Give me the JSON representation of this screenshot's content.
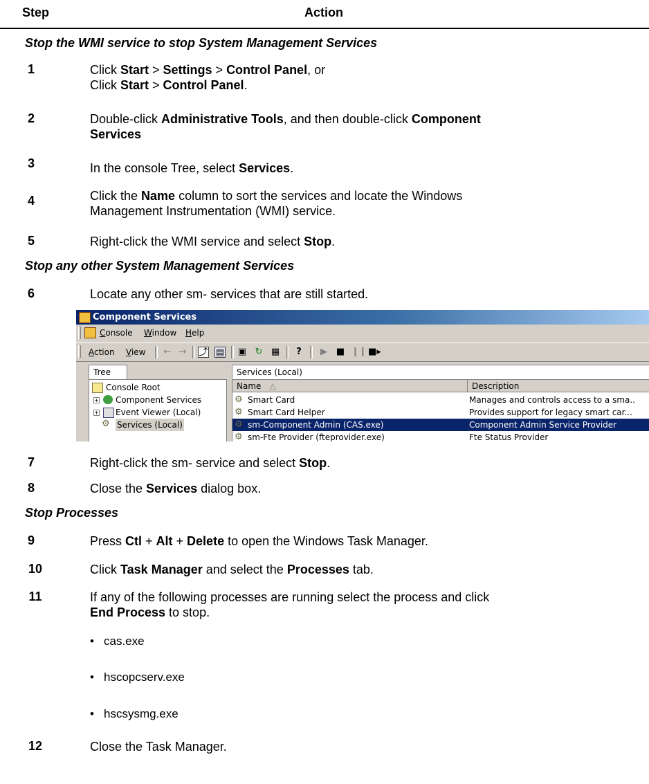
{
  "header": {
    "step_label": "Step",
    "action_label": "Action"
  },
  "sections": [
    "Stop the WMI service to stop System Management Services",
    "Stop any other System Management Services",
    "Stop Processes"
  ],
  "steps": [
    {
      "num": "1",
      "line1": [
        "Click ",
        "Start",
        " > ",
        "Settings",
        " > ",
        "Control Panel",
        ", or"
      ],
      "line2": [
        "Click ",
        "Start",
        " > ",
        "Control Panel",
        "."
      ]
    },
    {
      "num": "2",
      "line1": [
        "Double-click ",
        "Administrative Tools",
        ", and then double-click ",
        "Component"
      ],
      "line2": [
        "Services"
      ]
    },
    {
      "num": "3",
      "line1": [
        "In the console Tree, select ",
        "Services",
        "."
      ]
    },
    {
      "num": "4",
      "line1": [
        "Click the ",
        "Name",
        " column to sort the services and locate the Windows"
      ],
      "line2": [
        "Management Instrumentation (WMI) service."
      ]
    },
    {
      "num": "5",
      "line1": [
        "Right-click the WMI service and select ",
        "Stop",
        "."
      ]
    },
    {
      "num": "6",
      "line1": [
        "Locate any other sm- services that are still started."
      ]
    },
    {
      "num": "7",
      "line1": [
        "Right-click the sm- service and select ",
        "Stop",
        "."
      ]
    },
    {
      "num": "8",
      "line1": [
        "Close the ",
        "Services",
        " dialog box."
      ]
    },
    {
      "num": "9",
      "line1": [
        "Press ",
        "Ctl",
        " + ",
        "Alt",
        " + ",
        "Delete",
        " to open the Windows Task Manager."
      ]
    },
    {
      "num": "10",
      "line1": [
        "Click ",
        "Task Manager",
        " and select the ",
        "Processes",
        " tab."
      ]
    },
    {
      "num": "11",
      "line1": [
        "If any of the following processes are running select the process and click"
      ],
      "line2": [
        "End Process",
        " to stop."
      ]
    },
    {
      "num": "12",
      "line1": [
        "Close the Task Manager."
      ]
    }
  ],
  "processes": [
    "cas.exe",
    "hscopcserv.exe",
    "hscsysmg.exe"
  ],
  "screenshot": {
    "title": "Component Services",
    "menu": {
      "console_prefix": "C",
      "console_rest": "onsole",
      "window_prefix": "W",
      "window_rest": "indow",
      "help_prefix": "H",
      "help_rest": "elp"
    },
    "toolbar": {
      "action_prefix": "A",
      "action_rest": "ction",
      "view_prefix": "V",
      "view_rest": "iew"
    },
    "tree_tab": "Tree",
    "tree": [
      "Console Root",
      "Component Services",
      "Event Viewer (Local)",
      "Services (Local)"
    ],
    "pane_title": "Services (Local)",
    "columns": {
      "name": "Name",
      "description": "Description"
    },
    "rows": [
      {
        "name": "Smart Card",
        "description": "Manages and controls access to a sma..",
        "selected": false
      },
      {
        "name": "Smart Card Helper",
        "description": "Provides support for legacy smart car...",
        "selected": false
      },
      {
        "name": "sm-Component Admin (CAS.exe)",
        "description": "Component Admin Service Provider",
        "selected": true
      },
      {
        "name": "sm-Fte Provider (fteprovider.exe)",
        "description": "Fte Status Provider",
        "selected": false
      }
    ]
  }
}
